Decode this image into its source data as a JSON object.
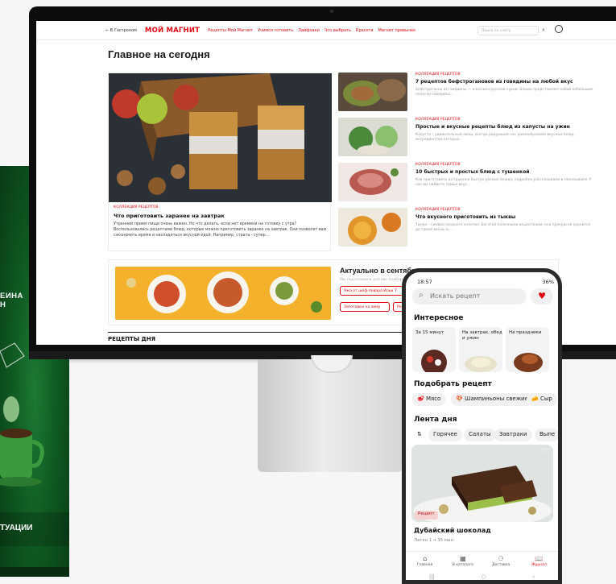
{
  "site": {
    "back_link": "← В Гастроном",
    "logo": "МОЙ МАГНИТ",
    "nav": [
      "Рецепты Мой Магнит",
      "Учимся готовить",
      "Лайфхаки",
      "Что выбрать",
      "Красота",
      "Магнит привычек"
    ],
    "search_placeholder": "Поиск по сайту",
    "page_heading": "Главное на сегодня",
    "hero": {
      "kicker": "КОЛЛЕКЦИЯ РЕЦЕПТОВ",
      "title": "Что приготовить заранее на завтрак",
      "desc": "Утренний прием пищи очень важен. Но что делать, если нет времени на готовку с утра? Воспользовались рецептами блюд, которые можно приготовить заранее на завтрак. Они позволят вам сэкономить время и насладиться вкусной едой. Например, страта - супер..."
    },
    "collections": [
      {
        "kicker": "КОЛЛЕКЦИЯ РЕЦЕПТОВ",
        "title": "7 рецептов бефстрогановов из говядины на любой вкус",
        "desc": "Бефстроганов из говядины — классика русской кухни. Блюдо представляет собой небольшие полоски говядины..."
      },
      {
        "kicker": "КОЛЛЕКЦИЯ РЕЦЕПТОВ",
        "title": "Простые и вкусные рецепты блюд из капусты на ужин",
        "desc": "Капуста – удивительный овощ, всегда радующий нас разнообразием вкусных блюд, ингредиентом которых..."
      },
      {
        "kicker": "КОЛЛЕКЦИЯ РЕЦЕПТОВ",
        "title": "10 быстрых и простых блюд с тушенкой",
        "desc": "Как приготовить из тушенки быстро разные блюда, подробно рассказываем и показываем. У нас вы найдете самые вкус..."
      },
      {
        "kicker": "КОЛЛЕКЦИЯ РЕЦЕПТОВ",
        "title": "Что вкусного приготовить из тыквы",
        "desc": "Тыква – символ позднего излетия. Богатая полезными веществами, она прекрасно хранится до самой весны и..."
      }
    ],
    "banner": {
      "title": "Актуально в сентябре",
      "sub": "Мы подготовили для вас подборки",
      "chips": [
        "Ужа от шеф-повара Ильи Т",
        "Заготовки на зиму",
        "Ре"
      ]
    },
    "recipes_day": "РЕЦЕПТЫ ДНЯ"
  },
  "poster": {
    "line1": "ЕИНА",
    "line2": "Н",
    "bottom": "ТУАЦИИ"
  },
  "phone": {
    "time": "18:57",
    "battery": "36%",
    "search_placeholder": "Искать рецепт",
    "interesting_title": "Интересное",
    "interesting_cards": [
      "За 15 минут",
      "На завтрак, обед и ужин",
      "На праздники"
    ],
    "pick_title": "Подобрать рецепт",
    "pick_chips": [
      "Мясо",
      "Шампиньоны свежие",
      "Сыр"
    ],
    "feed_title": "Лента дня",
    "feed_chips": [
      "Горячее",
      "Салаты",
      "Завтраки",
      "Выпе"
    ],
    "recipe_badge": "Рецепт",
    "recipe_title": "Дубайский шоколад",
    "recipe_meta": "Легко   1 ч 35 мин",
    "bottom_nav": [
      "Главная",
      "В каталоге",
      "Доставка",
      "Журнал"
    ]
  },
  "colors": {
    "brand_red": "#e30611",
    "poster_green": "#0f5a22"
  }
}
